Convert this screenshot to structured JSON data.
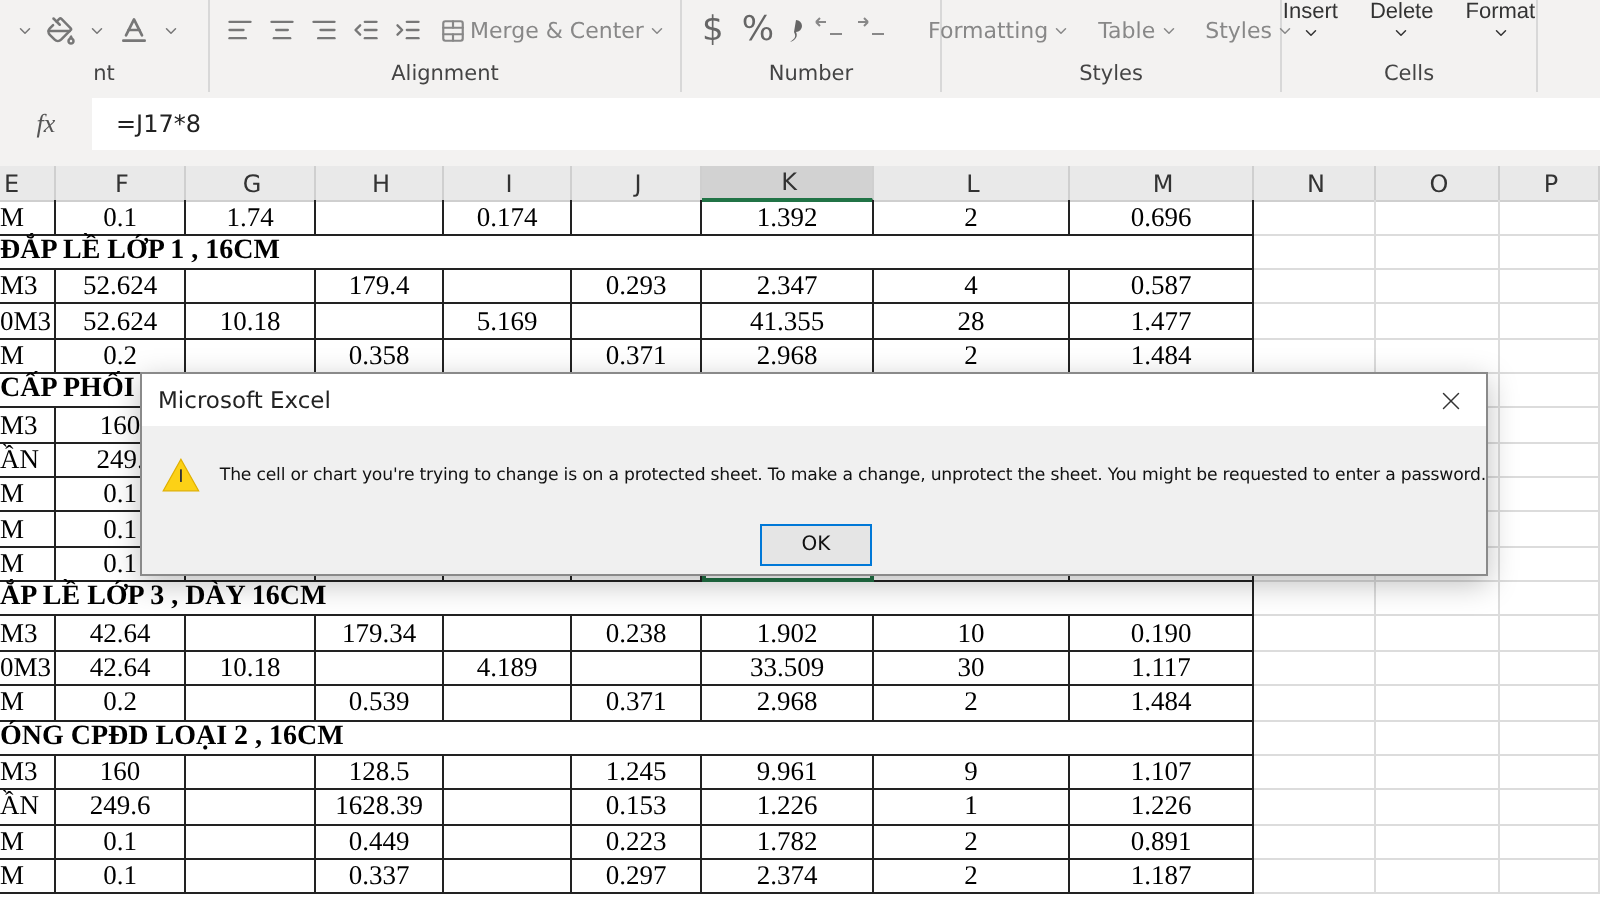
{
  "ribbon": {
    "groups": [
      {
        "kind": "font",
        "label": "nt"
      },
      {
        "kind": "alignment",
        "label": "Alignment",
        "button": "Merge & Center"
      },
      {
        "kind": "number",
        "label": "Number",
        "symbols": [
          "$",
          "%"
        ]
      },
      {
        "kind": "styles",
        "label": "Styles",
        "buttons": [
          "Formatting",
          "Table",
          "Styles"
        ]
      },
      {
        "kind": "cells",
        "label": "Cells",
        "buttons": [
          "Insert",
          "Delete",
          "Format"
        ]
      }
    ]
  },
  "formula_bar": {
    "function_label": "fx",
    "formula": "=J17*8"
  },
  "sheet": {
    "columns": [
      {
        "label": "E",
        "selected": false
      },
      {
        "label": "F",
        "selected": false
      },
      {
        "label": "G",
        "selected": false
      },
      {
        "label": "H",
        "selected": false
      },
      {
        "label": "I",
        "selected": false
      },
      {
        "label": "J",
        "selected": false
      },
      {
        "label": "K",
        "selected": true
      },
      {
        "label": "L",
        "selected": false
      },
      {
        "label": "M",
        "selected": false
      },
      {
        "label": "N",
        "selected": false
      },
      {
        "label": "O",
        "selected": false
      },
      {
        "label": "P",
        "selected": false
      }
    ],
    "rows": [
      {
        "kind": "data",
        "selected": false,
        "cells": [
          "M",
          "0.1",
          "1.74",
          "",
          "0.174",
          "",
          "1.392",
          "2",
          "0.696"
        ]
      },
      {
        "kind": "section",
        "title": "ĐẮP LỀ LỚP 1 , 16CM"
      },
      {
        "kind": "data",
        "selected": false,
        "cells": [
          "M3",
          "52.624",
          "",
          "179.4",
          "",
          "0.293",
          "2.347",
          "4",
          "0.587"
        ]
      },
      {
        "kind": "data",
        "selected": false,
        "cells": [
          "0M3",
          "52.624",
          "10.18",
          "",
          "5.169",
          "",
          "41.355",
          "28",
          "1.477"
        ]
      },
      {
        "kind": "data",
        "selected": false,
        "cells": [
          "M",
          "0.2",
          "",
          "0.358",
          "",
          "0.371",
          "2.968",
          "2",
          "1.484"
        ]
      },
      {
        "kind": "section",
        "title": "CẤP PHỐI"
      },
      {
        "kind": "data",
        "selected": false,
        "cells": [
          "M3",
          "160",
          "",
          "",
          "",
          "",
          "",
          "",
          ""
        ]
      },
      {
        "kind": "data",
        "selected": false,
        "cells": [
          "ẦN",
          "249.",
          "",
          "",
          "",
          "",
          "",
          "",
          ""
        ]
      },
      {
        "kind": "data",
        "selected": false,
        "cells": [
          "M",
          "0.1",
          "",
          "",
          "",
          "",
          "",
          "",
          ""
        ]
      },
      {
        "kind": "data",
        "selected": false,
        "cells": [
          "M",
          "0.1",
          "",
          "",
          "",
          "",
          "",
          "",
          ""
        ]
      },
      {
        "kind": "data",
        "selected": true,
        "cells": [
          "M",
          "0.1",
          "",
          "",
          "",
          "",
          "",
          "",
          ""
        ]
      },
      {
        "kind": "section",
        "title": "ẮP LỀ LỚP 3 , DÀY 16CM"
      },
      {
        "kind": "data",
        "selected": false,
        "cells": [
          "M3",
          "42.64",
          "",
          "179.34",
          "",
          "0.238",
          "1.902",
          "10",
          "0.190"
        ]
      },
      {
        "kind": "data",
        "selected": false,
        "cells": [
          "0M3",
          "42.64",
          "10.18",
          "",
          "4.189",
          "",
          "33.509",
          "30",
          "1.117"
        ]
      },
      {
        "kind": "data",
        "selected": false,
        "cells": [
          "M",
          "0.2",
          "",
          "0.539",
          "",
          "0.371",
          "2.968",
          "2",
          "1.484"
        ]
      },
      {
        "kind": "section",
        "title": "ÓNG CPĐD LOẠI 2 , 16CM"
      },
      {
        "kind": "data",
        "selected": false,
        "cells": [
          "M3",
          "160",
          "",
          "128.5",
          "",
          "1.245",
          "9.961",
          "9",
          "1.107"
        ]
      },
      {
        "kind": "data",
        "selected": false,
        "cells": [
          "ẦN",
          "249.6",
          "",
          "1628.39",
          "",
          "0.153",
          "1.226",
          "1",
          "1.226"
        ]
      },
      {
        "kind": "data",
        "selected": false,
        "cells": [
          "M",
          "0.1",
          "",
          "0.449",
          "",
          "0.223",
          "1.782",
          "2",
          "0.891"
        ]
      },
      {
        "kind": "data",
        "selected": false,
        "cells": [
          "M",
          "0.1",
          "",
          "0.337",
          "",
          "0.297",
          "2.374",
          "2",
          "1.187"
        ]
      }
    ]
  },
  "dialog": {
    "title": "Microsoft Excel",
    "message": "The cell or chart you're trying to change is on a protected sheet. To make a change, unprotect the sheet. You might be requested to enter a password.",
    "button": "OK"
  }
}
